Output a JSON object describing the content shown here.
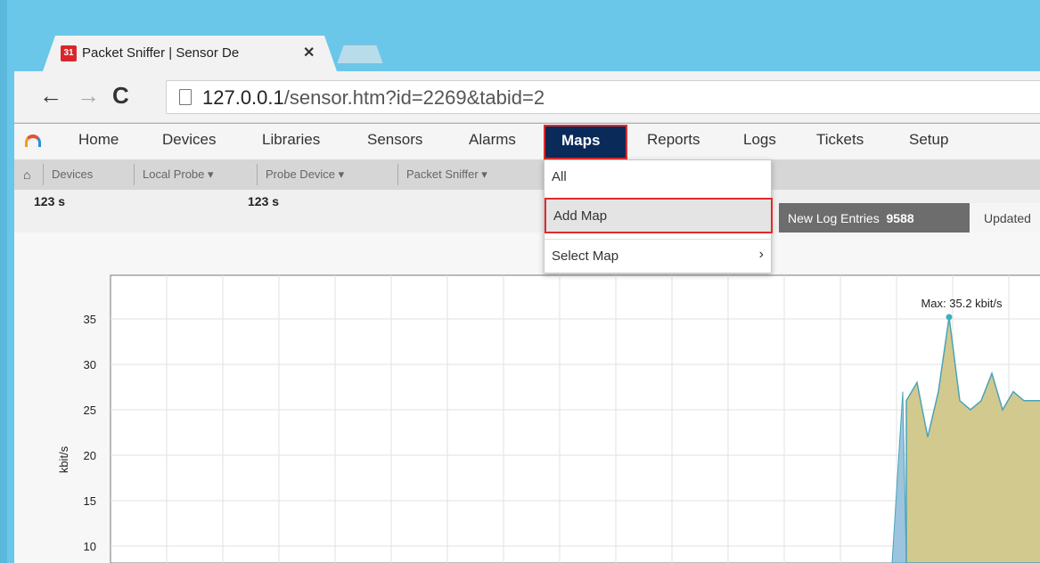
{
  "browser": {
    "tab_title": "Packet Sniffer | Sensor De",
    "tab_favicon_text": "31",
    "url_host": "127.0.0.1",
    "url_path": "/sensor.htm?id=2269&tabid=2"
  },
  "menu": {
    "items": [
      "Home",
      "Devices",
      "Libraries",
      "Sensors",
      "Alarms",
      "Maps",
      "Reports",
      "Logs",
      "Tickets",
      "Setup"
    ],
    "active": "Maps"
  },
  "breadcrumb": [
    "Devices",
    "Local Probe ▾",
    "Probe Device ▾",
    "Packet Sniffer ▾"
  ],
  "info": {
    "value1": "123 s",
    "value2": "123 s",
    "log_label": "New Log Entries",
    "log_count": "9588",
    "updated_label": "Updated"
  },
  "dropdown": {
    "items": [
      "All",
      "Add Map",
      "Select Map"
    ],
    "highlighted": "Add Map"
  },
  "chart_data": {
    "type": "area",
    "ylabel": "kbit/s",
    "yticks": [
      35,
      30,
      25,
      20,
      15,
      10
    ],
    "annotation": "Max: 35.2 kbit/s",
    "series": [
      {
        "name": "",
        "color": "#d2c98f",
        "values": [
          0,
          27,
          0,
          26,
          28,
          22,
          27,
          35.2,
          26,
          25,
          26,
          29,
          25,
          27,
          26
        ]
      }
    ]
  },
  "colors": {
    "brand_blue": "#0a2a5a",
    "highlight_red": "#e12a2a",
    "area_fill": "#d2c98f",
    "area_fill_secondary": "#9cc4df"
  }
}
